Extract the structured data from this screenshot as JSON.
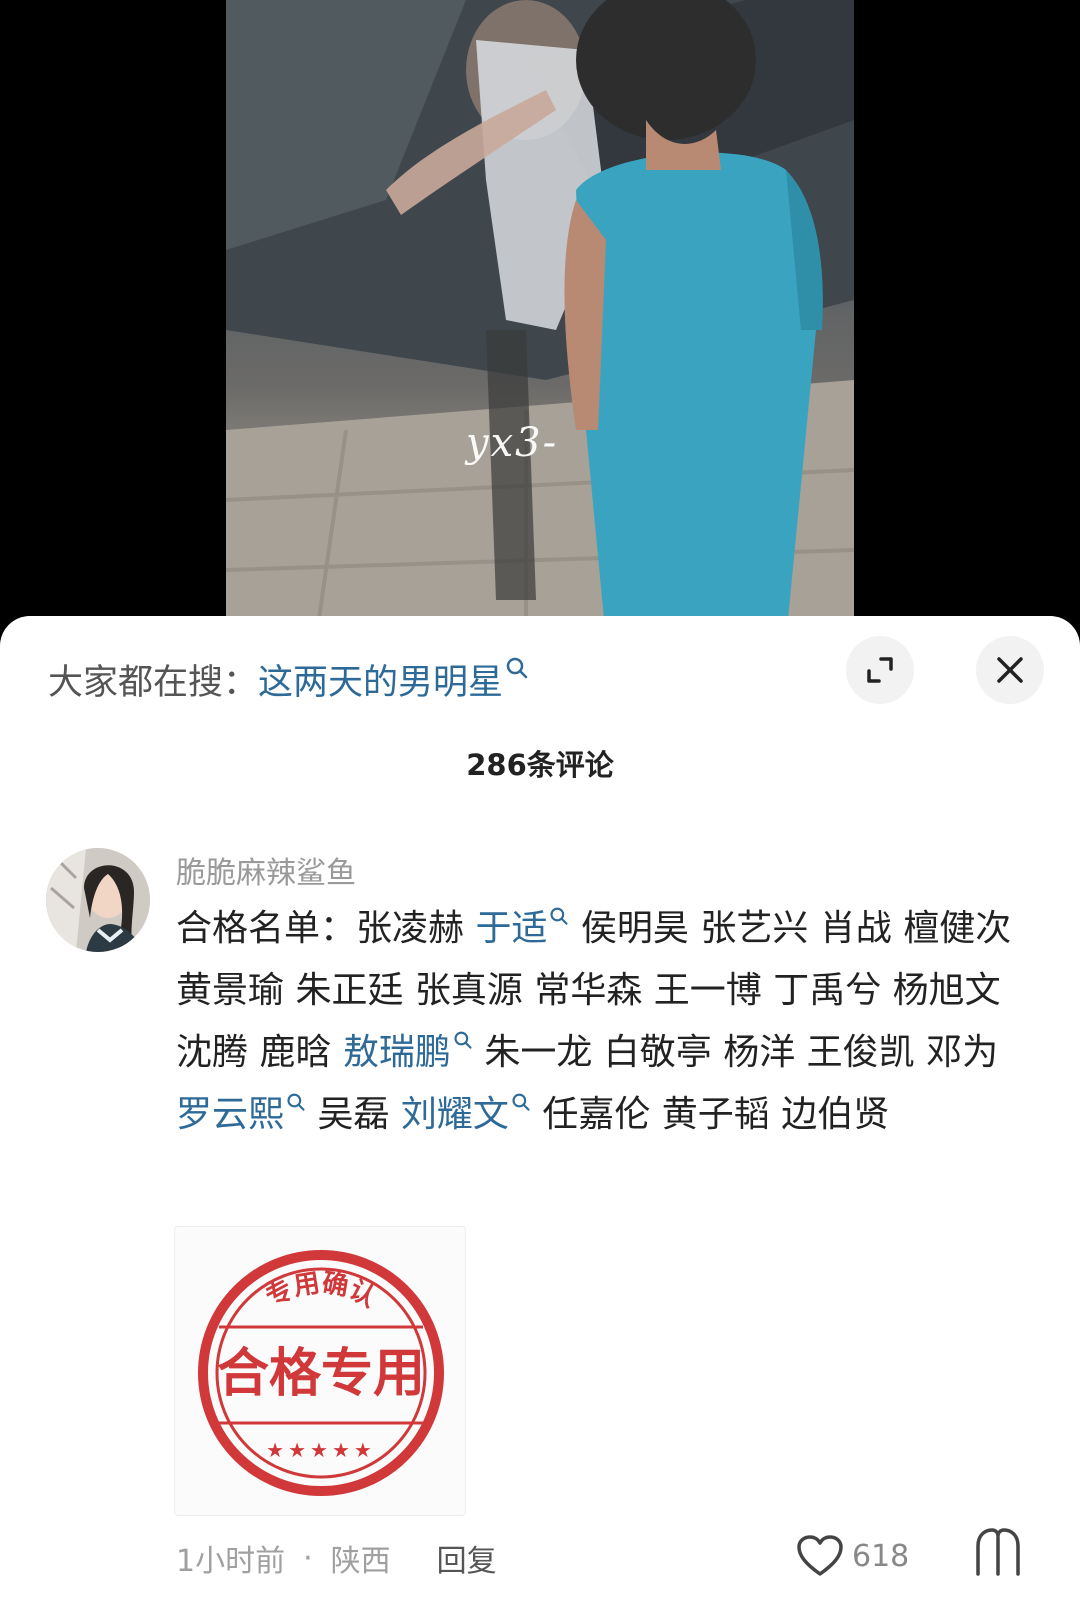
{
  "video": {
    "watermark_text": "yx3-",
    "icons": [
      "video-frame"
    ]
  },
  "search": {
    "prefix": "大家都在搜：",
    "term": "这两天的男明星",
    "icon": "search-icon"
  },
  "buttons": {
    "expand_icon": "expand-icon",
    "close_icon": "close-icon"
  },
  "comments_header": {
    "count_label": "286条评论"
  },
  "comment": {
    "username": "脆脆麻辣鲨鱼",
    "segments": [
      {
        "text": "合格名单：张凌赫 ",
        "keyword": false
      },
      {
        "text": "于适",
        "keyword": true
      },
      {
        "text": " 侯明昊 张艺兴 肖战 檀健次 黄景瑜 朱正廷 张真源 常华森 王一博 丁禹兮 杨旭文 沈腾 鹿晗 ",
        "keyword": false
      },
      {
        "text": "敖瑞鹏",
        "keyword": true
      },
      {
        "text": " 朱一龙 白敬亭 杨洋 王俊凯 邓为 ",
        "keyword": false
      },
      {
        "text": "罗云熙",
        "keyword": true
      },
      {
        "text": " 吴磊 ",
        "keyword": false
      },
      {
        "text": "刘耀文",
        "keyword": true
      },
      {
        "text": " 任嘉伦 黄子韬  边伯贤",
        "keyword": false
      }
    ],
    "stamp": {
      "top_text": "专用确认",
      "main_text": "合格专用",
      "stars": "★★★★★",
      "color": "#d0383a"
    },
    "time": "1小时前",
    "separator": "·",
    "location": "陕西",
    "reply_label": "回复",
    "like_count": "618",
    "like_icon": "heart-icon",
    "dislike_icon": "dislike-icon"
  },
  "colors": {
    "keyword": "#2e6a98",
    "muted": "#9a9a9a",
    "text": "#222222"
  }
}
